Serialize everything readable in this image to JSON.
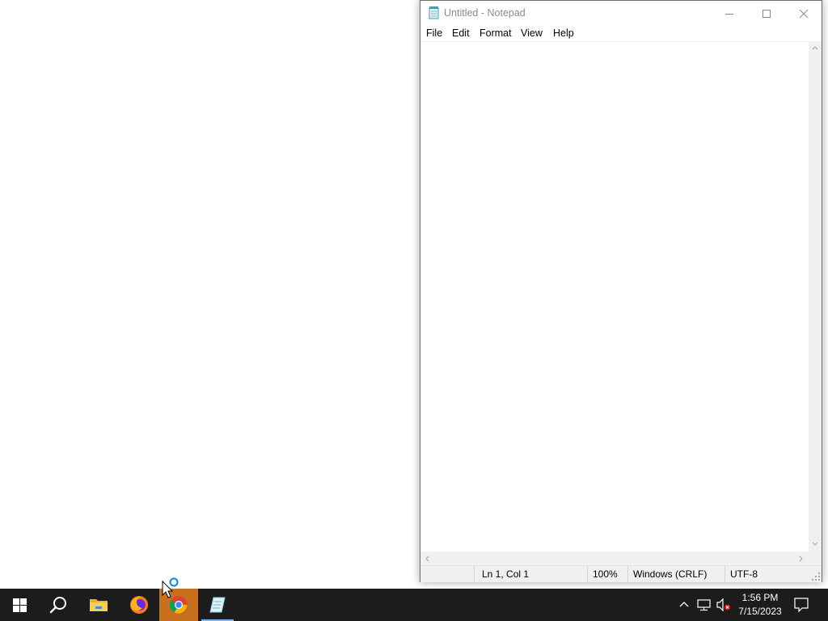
{
  "notepad": {
    "title": "Untitled - Notepad",
    "menu": [
      "File",
      "Edit",
      "Format",
      "View",
      "Help"
    ],
    "content": "",
    "status": {
      "position": "Ln 1, Col 1",
      "zoom": "100%",
      "line_ending": "Windows (CRLF)",
      "encoding": "UTF-8"
    }
  },
  "taskbar": {
    "apps": [
      "start-icon",
      "search-icon",
      "file-explorer-icon",
      "firefox-icon",
      "chrome-icon",
      "notepad-icon"
    ],
    "active_app": "chrome-icon",
    "open_app": "notepad-icon",
    "tray_icons": [
      "chevron-up-icon",
      "network-icon",
      "volume-muted-icon"
    ],
    "time": "1:56 PM",
    "date": "7/15/2023"
  },
  "colors": {
    "taskbar_bg": "#1c1c1c",
    "active_app_bg": "#c9701f",
    "open_app_underline": "#7fb0e0"
  }
}
